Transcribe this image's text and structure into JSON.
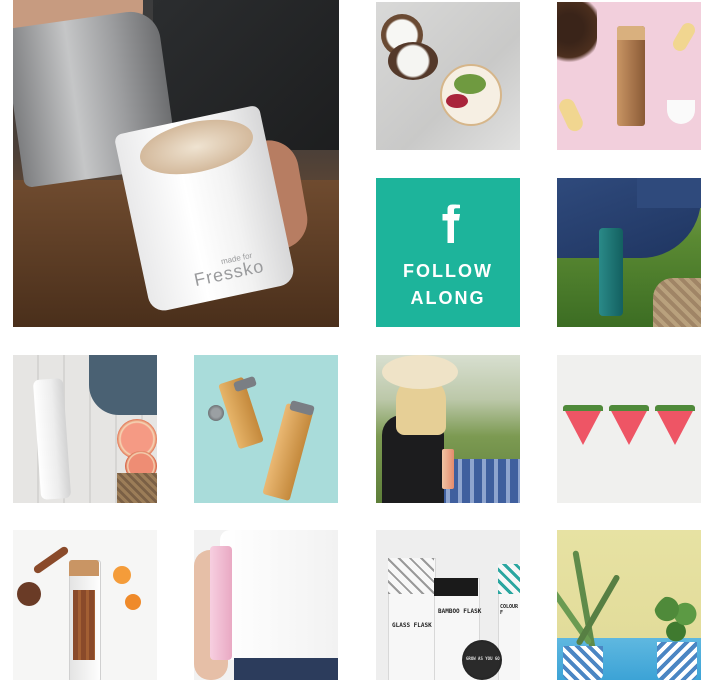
{
  "gallery": {
    "facebook_cta": {
      "line1": "FOLLOW",
      "line2": "ALONG",
      "icon": "facebook-icon"
    },
    "tiles": [
      {
        "name": "latte-cup",
        "brand_small": "made for",
        "brand": "Fressko"
      },
      {
        "name": "coconut-plate"
      },
      {
        "name": "bamboo-flask-pink"
      },
      {
        "name": "facebook-follow"
      },
      {
        "name": "grass-bottle"
      },
      {
        "name": "white-flask-grapefruit"
      },
      {
        "name": "bamboo-flasks-teal"
      },
      {
        "name": "picnic"
      },
      {
        "name": "watermelon-slices"
      },
      {
        "name": "spice-infuser"
      },
      {
        "name": "pink-flask"
      },
      {
        "name": "product-packaging",
        "labels": [
          "GLASS FLASK",
          "BAMBOO FLASK",
          "COLOUR F",
          "GROW AS YOU GO"
        ]
      },
      {
        "name": "potted-plants"
      }
    ]
  },
  "colors": {
    "facebook_tile": "#1db49b",
    "background": "#ffffff"
  }
}
